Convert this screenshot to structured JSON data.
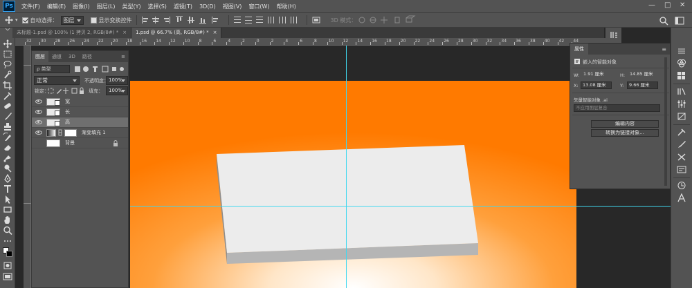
{
  "app": {
    "logo": "Ps"
  },
  "menubar": {
    "items": [
      "文件(F)",
      "编辑(E)",
      "图像(I)",
      "图层(L)",
      "类型(Y)",
      "选择(S)",
      "滤镜(T)",
      "3D(D)",
      "视图(V)",
      "窗口(W)",
      "帮助(H)"
    ],
    "window_controls": [
      "—",
      "□",
      "✕"
    ]
  },
  "options": {
    "auto_select_label": "自动选择：",
    "auto_select_value": "图层",
    "show_transform_label": "显示变换控件",
    "mode_3d_label": "3D 模式："
  },
  "tabs": [
    {
      "label": "未标题-1.psd @ 100% (1 拷贝 2, RGB/8#) *",
      "close": "×"
    },
    {
      "label": "1.psd @ 66.7% (高, RGB/8#) *",
      "close": "×"
    }
  ],
  "ruler": {
    "top": [
      "32",
      "30",
      "28",
      "26",
      "24",
      "22",
      "20",
      "18",
      "16",
      "14",
      "12",
      "10",
      "8",
      "6",
      "4",
      "2",
      "0",
      "2",
      "4",
      "6",
      "8",
      "10",
      "12",
      "14",
      "16",
      "18",
      "20",
      "22",
      "24",
      "26",
      "28",
      "30",
      "32",
      "34",
      "36",
      "38",
      "40",
      "42",
      "44",
      "46",
      "48"
    ]
  },
  "layers_panel": {
    "tabs": [
      "图层",
      "通道",
      "3D",
      "路径"
    ],
    "filter_label": "ρ 类型",
    "blend_mode": "正常",
    "opacity_label": "不透明度：",
    "opacity_value": "100%",
    "lock_label": "锁定：",
    "fill_label": "填充：",
    "fill_value": "100%",
    "layers": [
      {
        "name": "宽",
        "type": "smart"
      },
      {
        "name": "长",
        "type": "smart"
      },
      {
        "name": "高",
        "type": "smart",
        "selected": true
      },
      {
        "name": "渐变填充 1",
        "type": "gradient"
      },
      {
        "name": "背景",
        "type": "background"
      }
    ]
  },
  "properties_panel": {
    "title": "属性",
    "section": "嵌入的智能对象",
    "w_label": "W:",
    "w_value": "1.91 厘米",
    "h_label": "H:",
    "h_value": "14.85 厘米",
    "x_label": "X:",
    "x_value": "13.08 厘米",
    "y_label": "Y:",
    "y_value": "9.66 厘米",
    "vector_label": "矢量智能对象 .ai",
    "comp_placeholder": "不应用图层复合",
    "edit_button": "编辑内容",
    "convert_button": "转换为链接对象..."
  },
  "colors": {
    "canvas_orange": "#ff7f00",
    "canvas_highlight": "#ffffff",
    "guide": "#3fd8f0",
    "panel_bg": "#535353"
  }
}
